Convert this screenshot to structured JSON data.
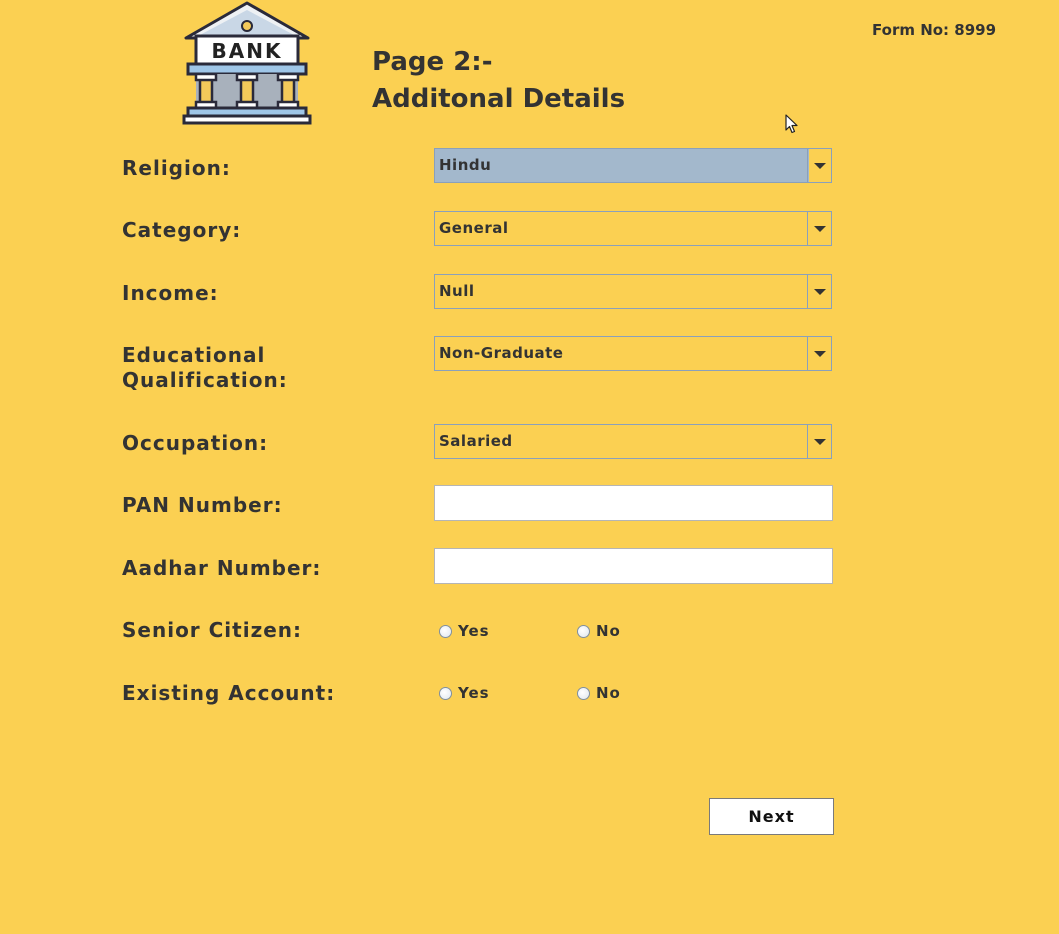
{
  "header": {
    "form_no": "Form No: 8999",
    "page_title": "Page 2:-",
    "page_subtitle": "Additonal Details",
    "logo_text": "BANK"
  },
  "fields": {
    "religion": {
      "label": "Religion:",
      "value": "Hindu"
    },
    "category": {
      "label": "Category:",
      "value": "General"
    },
    "income": {
      "label": "Income:",
      "value": "Null"
    },
    "education": {
      "label_line1": "Educational",
      "label_line2": "Qualification:",
      "value": "Non-Graduate"
    },
    "occupation": {
      "label": "Occupation:",
      "value": "Salaried"
    },
    "pan": {
      "label": "PAN Number:",
      "value": ""
    },
    "aadhar": {
      "label": "Aadhar Number:",
      "value": ""
    },
    "senior_citizen": {
      "label": "Senior Citizen:",
      "yes": "Yes",
      "no": "No"
    },
    "existing_account": {
      "label": "Existing Account:",
      "yes": "Yes",
      "no": "No"
    }
  },
  "actions": {
    "next_label": "Next"
  },
  "colors": {
    "background": "#fbd052",
    "selected_combo": "#a3b8cc",
    "text": "#333333"
  },
  "icons": {
    "logo": "bank-building-icon",
    "dropdown": "chevron-down-icon",
    "cursor": "mouse-pointer-icon"
  }
}
